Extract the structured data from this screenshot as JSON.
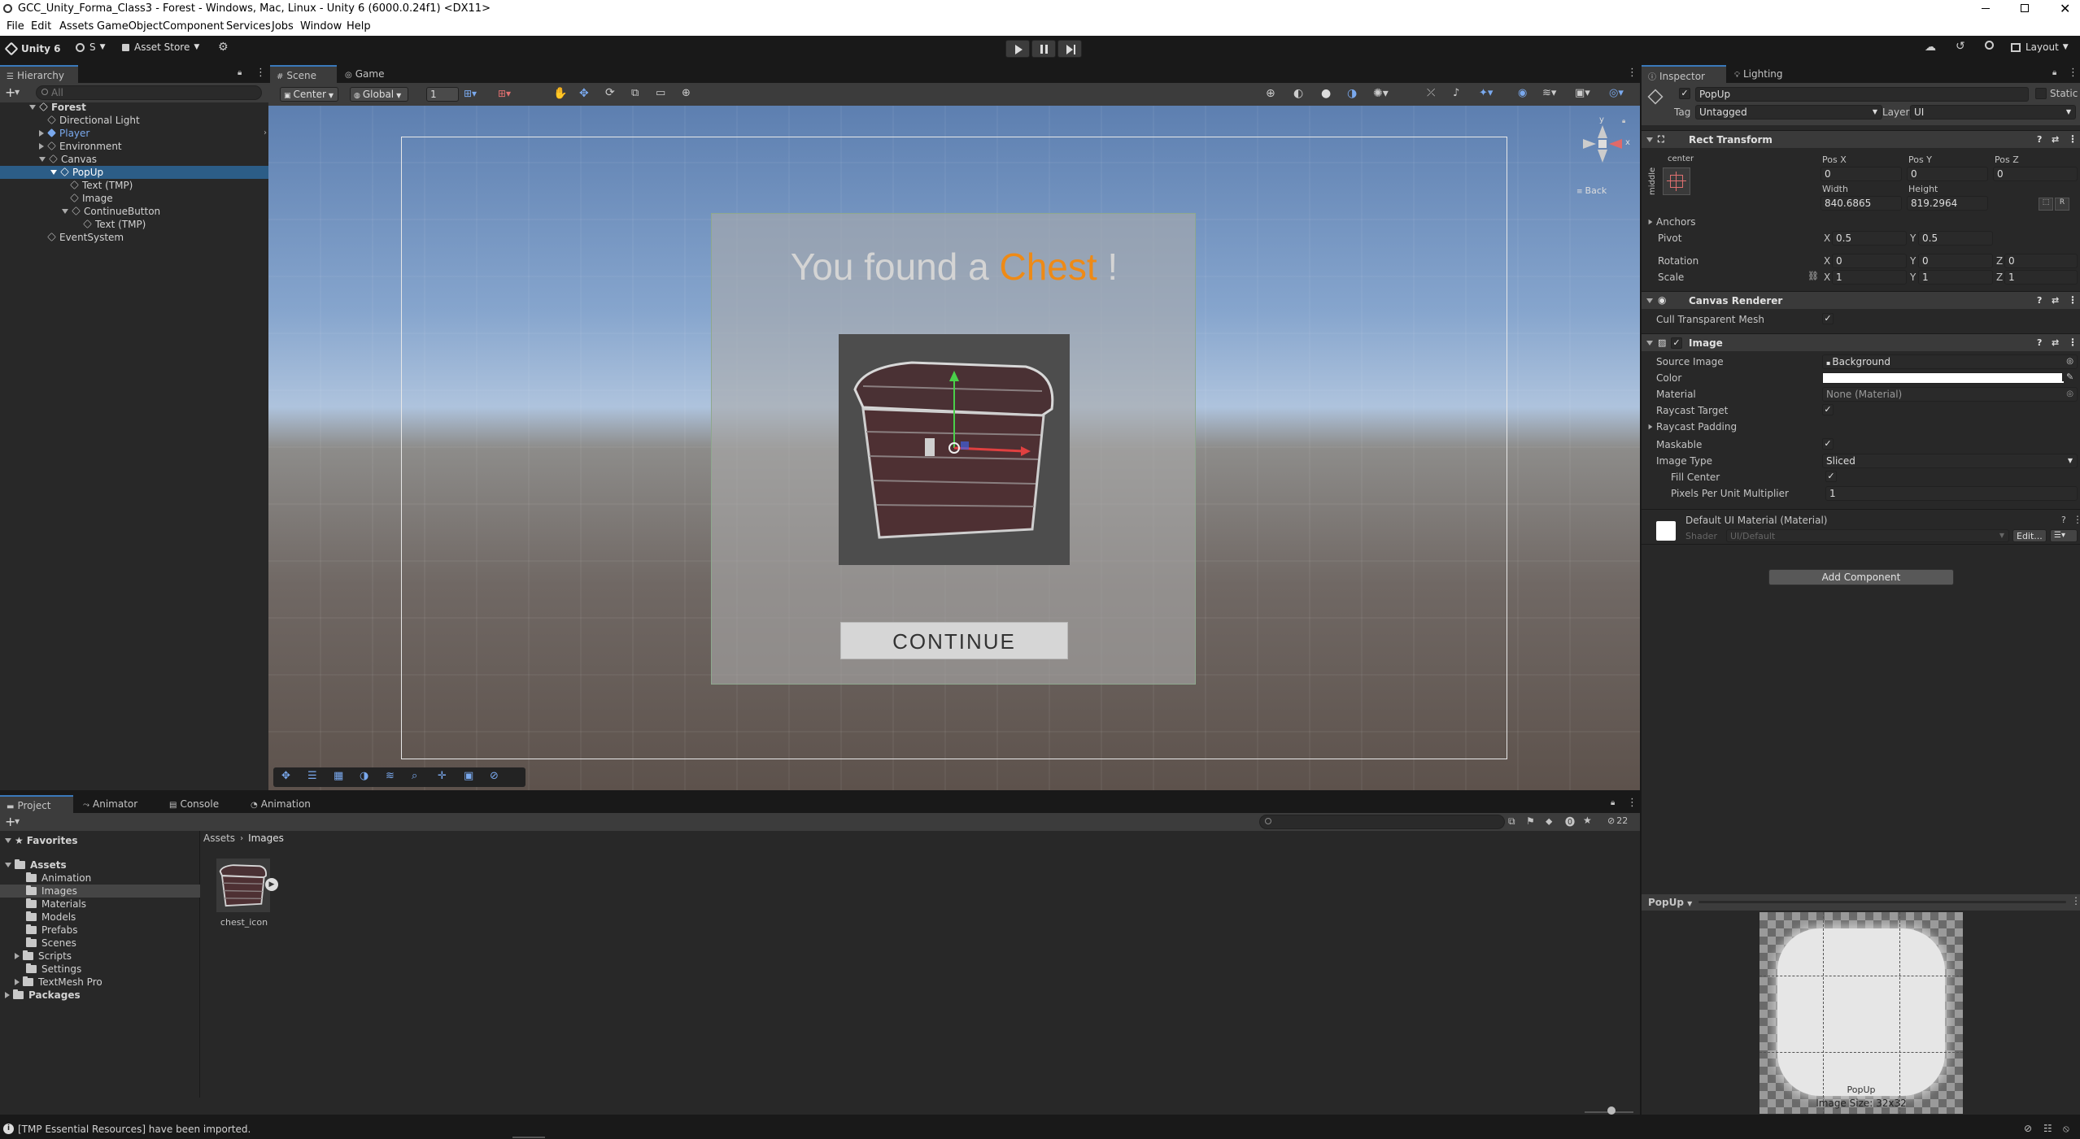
{
  "window": {
    "title": "GCC_Unity_Forma_Class3 - Forest - Windows, Mac, Linux - Unity 6 (6000.0.24f1) <DX11>"
  },
  "menu": [
    "File",
    "Edit",
    "Assets",
    "GameObject",
    "Component",
    "Services",
    "Jobs",
    "Window",
    "Help"
  ],
  "toolbar": {
    "unity_label": "Unity 6",
    "account_label": "S",
    "asset_store_label": "Asset Store",
    "layout_label": "Layout"
  },
  "hierarchy": {
    "tab": "Hierarchy",
    "search_placeholder": "All",
    "items": [
      {
        "label": "Forest"
      },
      {
        "label": "Directional Light"
      },
      {
        "label": "Player"
      },
      {
        "label": "Environment"
      },
      {
        "label": "Canvas"
      },
      {
        "label": "PopUp"
      },
      {
        "label": "Text (TMP)"
      },
      {
        "label": "Image"
      },
      {
        "label": "ContinueButton"
      },
      {
        "label": "Text (TMP)"
      },
      {
        "label": "EventSystem"
      }
    ]
  },
  "scene": {
    "tabs": [
      "Scene",
      "Game"
    ],
    "pivot_label": "Center",
    "space_label": "Global",
    "snap_value": "1",
    "back_label": "Back",
    "gizmo_axes": {
      "y": "y",
      "x": "x"
    },
    "popup_title_prefix": "You found a ",
    "popup_title_highlight": "Chest",
    "popup_title_suffix": " !",
    "continue_label": "CONTINUE",
    "highlight_color": "#ee8a16"
  },
  "inspector": {
    "tabs": [
      "Inspector",
      "Lighting"
    ],
    "object_name": "PopUp",
    "static_label": "Static",
    "tag_label": "Tag",
    "tag_value": "Untagged",
    "layer_label": "Layer",
    "layer_value": "UI",
    "rect": {
      "title": "Rect Transform",
      "anchor_h": "center",
      "anchor_v": "middle",
      "posx_label": "Pos X",
      "posy_label": "Pos Y",
      "posz_label": "Pos Z",
      "posx": "0",
      "posy": "0",
      "posz": "0",
      "width_label": "Width",
      "height_label": "Height",
      "width": "840.6865",
      "height": "819.2964",
      "anchors_label": "Anchors",
      "pivot_label": "Pivot",
      "pivot_x": "0.5",
      "pivot_y": "0.5",
      "rotation_label": "Rotation",
      "rot_x": "0",
      "rot_y": "0",
      "rot_z": "0",
      "scale_label": "Scale",
      "scale_x": "1",
      "scale_y": "1",
      "scale_z": "1",
      "x": "X",
      "y": "Y",
      "z": "Z",
      "r_label": "R"
    },
    "canvas_renderer": {
      "title": "Canvas Renderer",
      "cull_label": "Cull Transparent Mesh"
    },
    "image": {
      "title": "Image",
      "source_label": "Source Image",
      "source_value": "Background",
      "color_label": "Color",
      "material_label": "Material",
      "material_value": "None (Material)",
      "raycast_label": "Raycast Target",
      "raycast_padding_label": "Raycast Padding",
      "maskable_label": "Maskable",
      "image_type_label": "Image Type",
      "image_type_value": "Sliced",
      "fill_center_label": "Fill Center",
      "ppu_label": "Pixels Per Unit Multiplier",
      "ppu_value": "1"
    },
    "material": {
      "title": "Default UI Material (Material)",
      "shader_label": "Shader",
      "shader_value": "UI/Default",
      "edit_label": "Edit..."
    },
    "add_component": "Add Component",
    "preview": {
      "title": "PopUp",
      "name": "PopUp",
      "size": "Image Size: 32x32"
    }
  },
  "project": {
    "tabs": [
      "Project",
      "Animator",
      "Console",
      "Animation"
    ],
    "favorites_label": "Favorites",
    "tree": [
      {
        "label": "Assets"
      },
      {
        "label": "Animation"
      },
      {
        "label": "Images"
      },
      {
        "label": "Materials"
      },
      {
        "label": "Models"
      },
      {
        "label": "Prefabs"
      },
      {
        "label": "Scenes"
      },
      {
        "label": "Scripts"
      },
      {
        "label": "Settings"
      },
      {
        "label": "TextMesh Pro"
      },
      {
        "label": "Packages"
      }
    ],
    "breadcrumb": [
      "Assets",
      "Images"
    ],
    "asset_name": "chest_icon",
    "count": "22"
  },
  "status": {
    "message": "[TMP Essential Resources] have been imported."
  }
}
